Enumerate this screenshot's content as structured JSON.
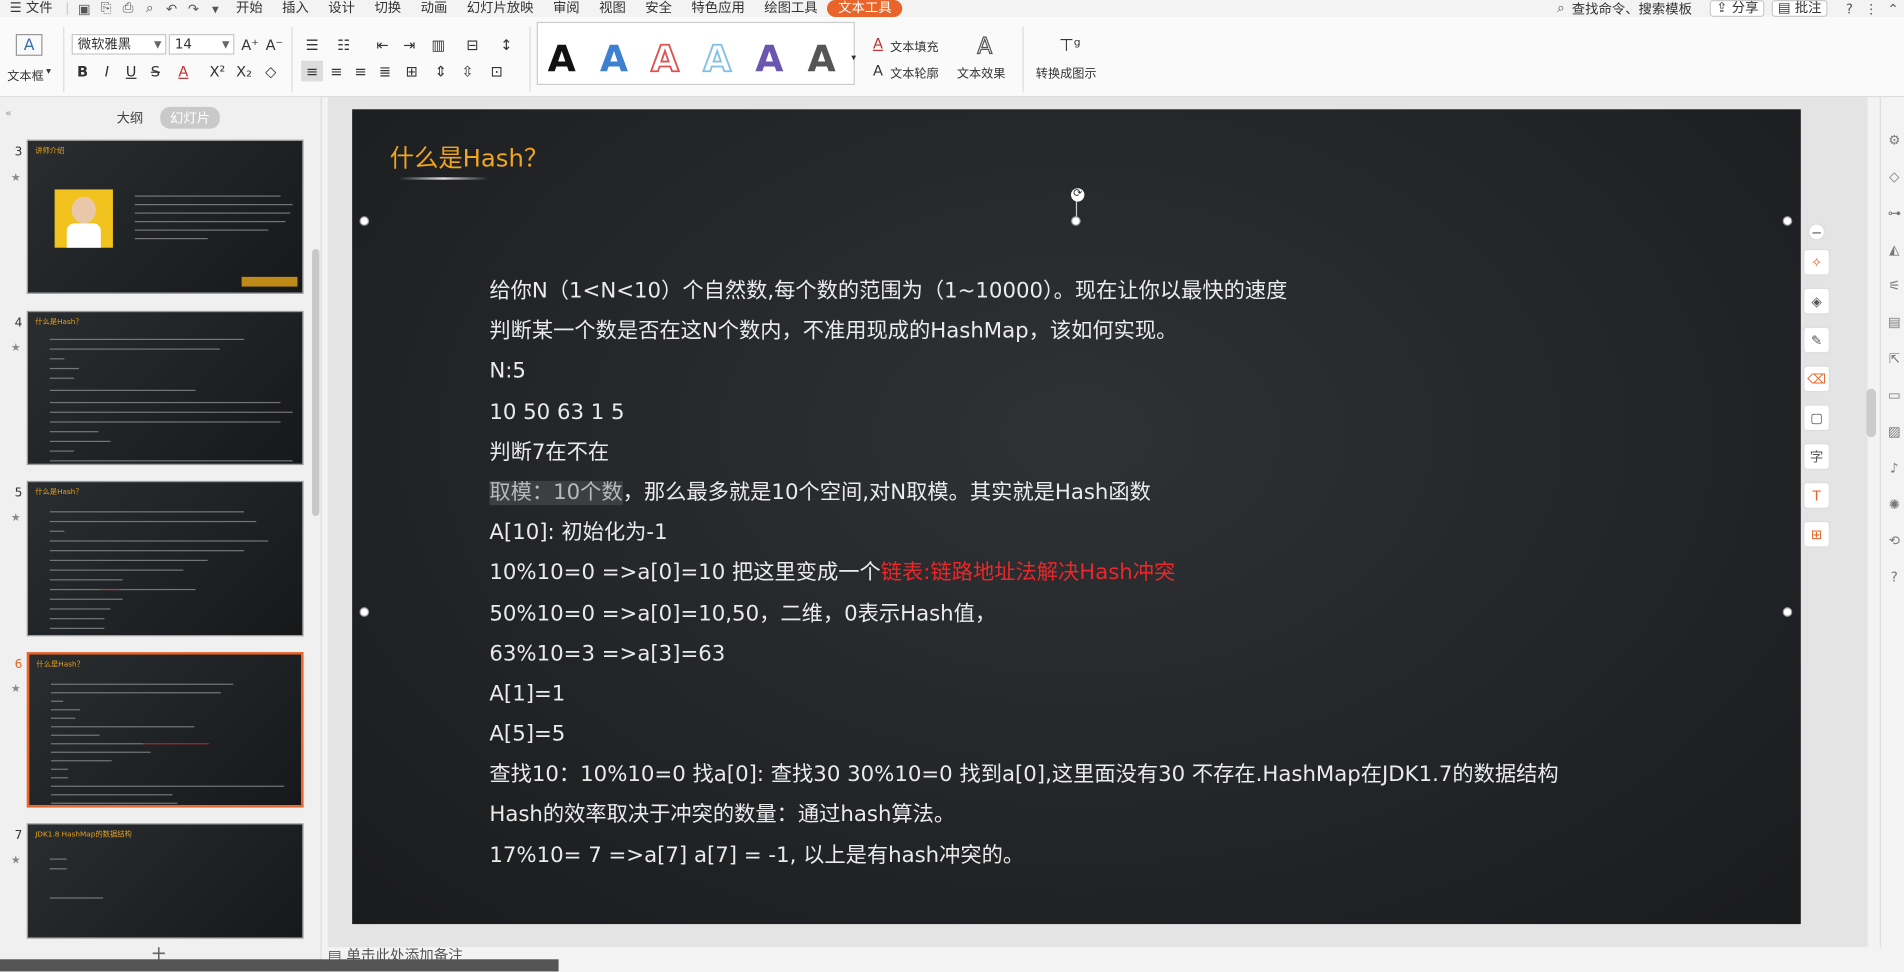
{
  "menubar": {
    "file": "文件",
    "items": [
      "开始",
      "插入",
      "设计",
      "切换",
      "动画",
      "幻灯片放映",
      "审阅",
      "视图",
      "安全",
      "特色应用",
      "绘图工具"
    ],
    "active_tab": "文本工具",
    "search": "查找命令、搜索模板",
    "share": "分享",
    "comment": "批注",
    "help": "?"
  },
  "ribbon": {
    "textbox_label": "文本框",
    "font_name": "微软雅黑",
    "font_size": "14",
    "text_fill": "文本填充",
    "text_outline": "文本轮廓",
    "text_effect": "文本效果",
    "convert": "转换成图示",
    "style_letter": "A",
    "style_colors": [
      "#111111",
      "#3f7fd0",
      "#e05050",
      "#7fc0e8",
      "#6a55b0",
      "#555555"
    ]
  },
  "left_panel": {
    "tab_outline": "大纲",
    "tab_slides": "幻灯片",
    "slides": [
      {
        "num": "3",
        "title": "讲师介绍"
      },
      {
        "num": "4",
        "title": "什么是Hash？"
      },
      {
        "num": "5",
        "title": "什么是Hash？"
      },
      {
        "num": "6",
        "title": "什么是Hash？",
        "selected": true
      },
      {
        "num": "7",
        "title": "JDK1.8 HashMap的数据结构"
      }
    ],
    "notes_placeholder": "单击此处添加备注"
  },
  "slide": {
    "title": "什么是Hash？",
    "lines": [
      "给你N（1<N<10）个自然数,每个数的范围为（1~10000）。现在让你以最快的速度",
      "判断某一个数是否在这N个数内，不准用现成的HashMap，该如何实现。",
      "N:5",
      "10 50 63 1 5",
      "判断7在不在",
      "，那么最多就是10个空间,对N取模。其实就是Hash函数",
      "A[10]: 初始化为-1",
      "10%10=0 =>a[0]=10 把这里变成一个",
      "50%10=0 =>a[0]=10,50，二维，0表示Hash值，",
      "63%10=3 =>a[3]=63",
      "A[1]=1",
      "A[5]=5",
      "查找10：10%10=0 找a[0]: 查找30 30%10=0 找到a[0],这里面没有30 不存在.HashMap在JDK1.7的数据结构",
      "Hash的效率取决于冲突的数量：通过hash算法。",
      "17%10= 7 =>a[7] a[7] = -1, 以上是有hash冲突的。"
    ],
    "highlight_prefix": "取模：10个数",
    "red_suffix": "链表:链路地址法解决Hash冲突"
  }
}
